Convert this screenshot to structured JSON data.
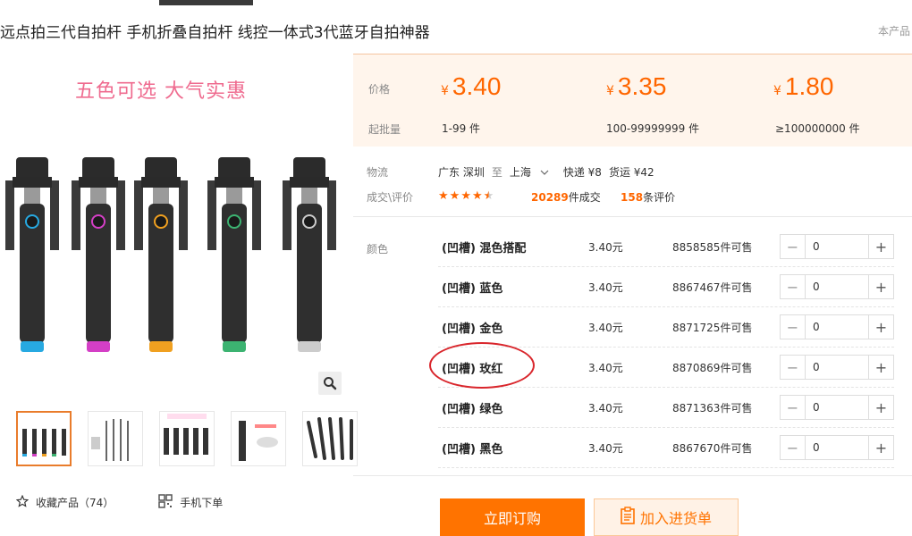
{
  "product": {
    "title": "远点拍三代自拍杆 手机折叠自拍杆 线控一体式3代蓝牙自拍神器",
    "title_right": "本产品",
    "promo_text": "五色可选  大气实惠"
  },
  "actions": {
    "favorite_label": "收藏产品（74）",
    "mobile_order_label": "手机下单"
  },
  "pricing": {
    "price_label": "价格",
    "moq_label": "起批量",
    "currency": "¥",
    "tiers": [
      {
        "price": "3.40",
        "qty": "1-99 件"
      },
      {
        "price": "3.35",
        "qty": "100-99999999 件"
      },
      {
        "price": "1.80",
        "qty": "≥100000000 件"
      }
    ]
  },
  "logistics": {
    "label": "物流",
    "from": "广东 深圳",
    "to_word": "至",
    "dest": "上海",
    "express": "快递 ¥8",
    "freight": "货运 ¥42"
  },
  "reviews": {
    "label": "成交\\评价",
    "rating": 4.5,
    "sales_count": "20289",
    "sales_suffix": "件成交",
    "review_count": "158",
    "review_suffix": "条评价"
  },
  "sku": {
    "label": "颜色",
    "rows": [
      {
        "name": "(凹槽) 混色搭配",
        "price": "3.40元",
        "stock": "8858585件可售",
        "qty": "0"
      },
      {
        "name": "(凹槽) 蓝色",
        "price": "3.40元",
        "stock": "8867467件可售",
        "qty": "0"
      },
      {
        "name": "(凹槽) 金色",
        "price": "3.40元",
        "stock": "8871725件可售",
        "qty": "0"
      },
      {
        "name": "(凹槽) 玫红",
        "price": "3.40元",
        "stock": "8870869件可售",
        "qty": "0"
      },
      {
        "name": "(凹槽) 绿色",
        "price": "3.40元",
        "stock": "8871363件可售",
        "qty": "0"
      },
      {
        "name": "(凹槽) 黑色",
        "price": "3.40元",
        "stock": "8867670件可售",
        "qty": "0"
      }
    ]
  },
  "buttons": {
    "buy_now": "立即订购",
    "add_cart": "加入进货单"
  },
  "colors": {
    "accent": "#ff6600",
    "ring_colors": [
      "#27a9e1",
      "#d43fc6",
      "#f0a020",
      "#3cb371",
      "#cccccc"
    ],
    "highlight_circle": "#d9262c"
  }
}
